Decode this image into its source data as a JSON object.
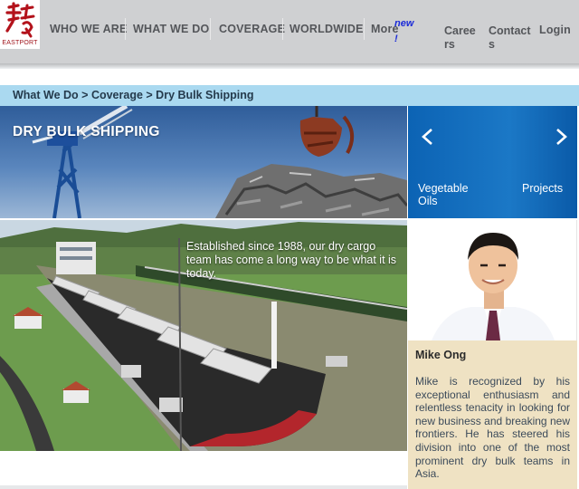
{
  "logo": {
    "text": "EASTPORT"
  },
  "nav": {
    "items": [
      {
        "label": "WHO WE ARE"
      },
      {
        "label": "WHAT WE DO"
      },
      {
        "label": "COVERAGE"
      },
      {
        "label": "WORLDWIDE"
      },
      {
        "label": "More"
      }
    ],
    "new_badge": "new",
    "new_badge_mark": "!",
    "careers": "Careers",
    "contact": "Contacts",
    "login": "Login"
  },
  "breadcrumb": {
    "items": [
      "What We Do",
      "Coverage",
      "Dry Bulk Shipping"
    ],
    "separator": " > "
  },
  "hero": {
    "title": "DRY BULK SHIPPING"
  },
  "carousel": {
    "prev_glyph": "<",
    "next_glyph": ">",
    "items": [
      "Vegetable Oils",
      "Projects"
    ]
  },
  "photo": {
    "caption": "Established since 1988, our dry cargo team has come a long way to be what it is today."
  },
  "profile": {
    "name": "Mike Ong",
    "bio": "Mike is recognized by his exceptional enthusiasm and relentless tenacity in looking for new business and breaking new frontiers. He has steered his division into one of the most prominent dry bulk teams in Asia."
  },
  "colors": {
    "nav_bg": "#cfd0d2",
    "breadcrumb_bg": "#aad9f0",
    "carousel_bg": "#1b78c6",
    "bio_bg": "#efe2c3",
    "badge": "#1a2ad8"
  }
}
